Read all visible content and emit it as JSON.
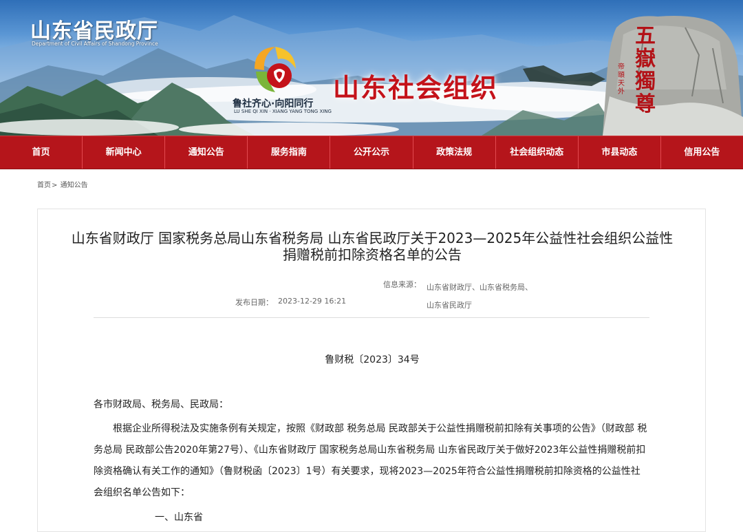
{
  "header": {
    "site_title": "山东省民政厅",
    "site_subtitle": "Department of Civil Affairs of Shandong Province",
    "slogan": "鲁社齐心·向阳同行",
    "slogan_pinyin": "LU SHE QI XIN · XIANG YANG TONG XING",
    "portal_name": "山东社会组织",
    "stele_text": "五嶽獨尊",
    "stele_subtext": "帝頤天外",
    "colors": {
      "nav": "#b5151b",
      "portal": "#c4121a"
    }
  },
  "nav": {
    "items": [
      "首页",
      "新闻中心",
      "通知公告",
      "服务指南",
      "公开公示",
      "政策法规",
      "社会组织动态",
      "市县动态",
      "信用公告"
    ]
  },
  "breadcrumb": {
    "home": "首页",
    "sep": ">",
    "current": "通知公告"
  },
  "article": {
    "title": "山东省财政厅 国家税务总局山东省税务局 山东省民政厅关于2023—2025年公益性社会组织公益性捐赠税前扣除资格名单的公告",
    "source_label": "信息来源：",
    "source_value": "山东省财政厅、山东省税务局、山东省民政厅",
    "date_label": "发布日期：",
    "date_value": "2023-12-29 16:21",
    "doc_no": "鲁财税〔2023〕34号",
    "salutation": "各市财政局、税务局、民政局：",
    "paragraph": "根据企业所得税法及实施条例有关规定，按照《财政部 税务总局 民政部关于公益性捐赠税前扣除有关事项的公告》（财政部 税务总局 民政部公告2020年第27号）、《山东省财政厅 国家税务总局山东省税务局 山东省民政厅关于做好2023年公益性捐赠税前扣除资格确认有关工作的通知》（鲁财税函〔2023〕1号）有关要求，现将2023—2025年符合公益性捐赠税前扣除资格的公益性社会组织名单公告如下：",
    "truncated_line": "一、山东省"
  }
}
